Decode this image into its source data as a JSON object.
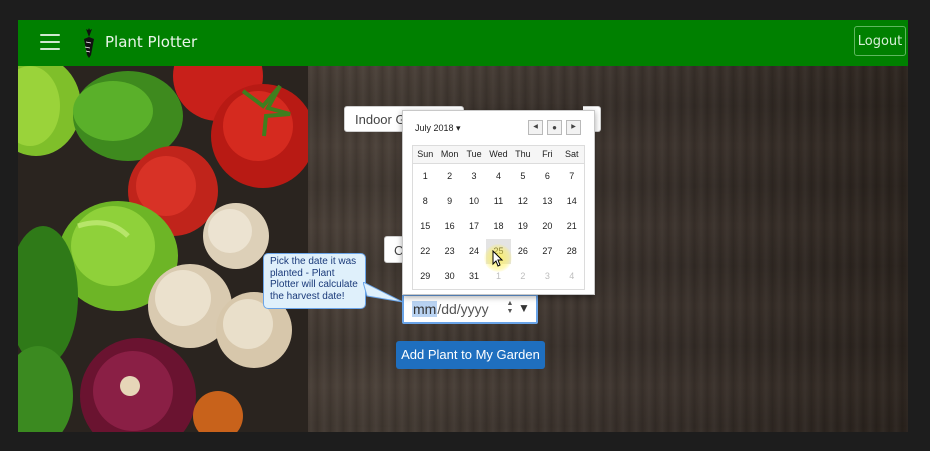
{
  "app": {
    "brand": "Plant Plotter",
    "logout_label": "Logout"
  },
  "form": {
    "location_value": "Indoor Ga",
    "second_field_value": "C",
    "date_placeholder_mm": "mm",
    "date_placeholder_rest": "/dd/yyyy",
    "submit_label": "Add Plant to My Garden"
  },
  "tooltip": {
    "text": "Pick the date it was planted - Plant Plotter will calculate the harvest date!"
  },
  "calendar": {
    "month_label": "July 2018",
    "weekdays": [
      "Sun",
      "Mon",
      "Tue",
      "Wed",
      "Thu",
      "Fri",
      "Sat"
    ],
    "weeks": [
      [
        "1",
        "2",
        "3",
        "4",
        "5",
        "6",
        "7"
      ],
      [
        "8",
        "9",
        "10",
        "11",
        "12",
        "13",
        "14"
      ],
      [
        "15",
        "16",
        "17",
        "18",
        "19",
        "20",
        "21"
      ],
      [
        "22",
        "23",
        "24",
        "25",
        "26",
        "27",
        "28"
      ],
      [
        "29",
        "30",
        "31",
        "1",
        "2",
        "3",
        "4"
      ]
    ],
    "hovered_day": "25"
  },
  "colors": {
    "navbar": "#008000",
    "button": "#1f6fbf",
    "focus_border": "#6aa4e8"
  },
  "icons": {
    "menu": "hamburger-icon",
    "logo": "carrot-icon",
    "prev": "chevron-left-icon",
    "today": "dot-icon",
    "next": "chevron-right-icon"
  }
}
